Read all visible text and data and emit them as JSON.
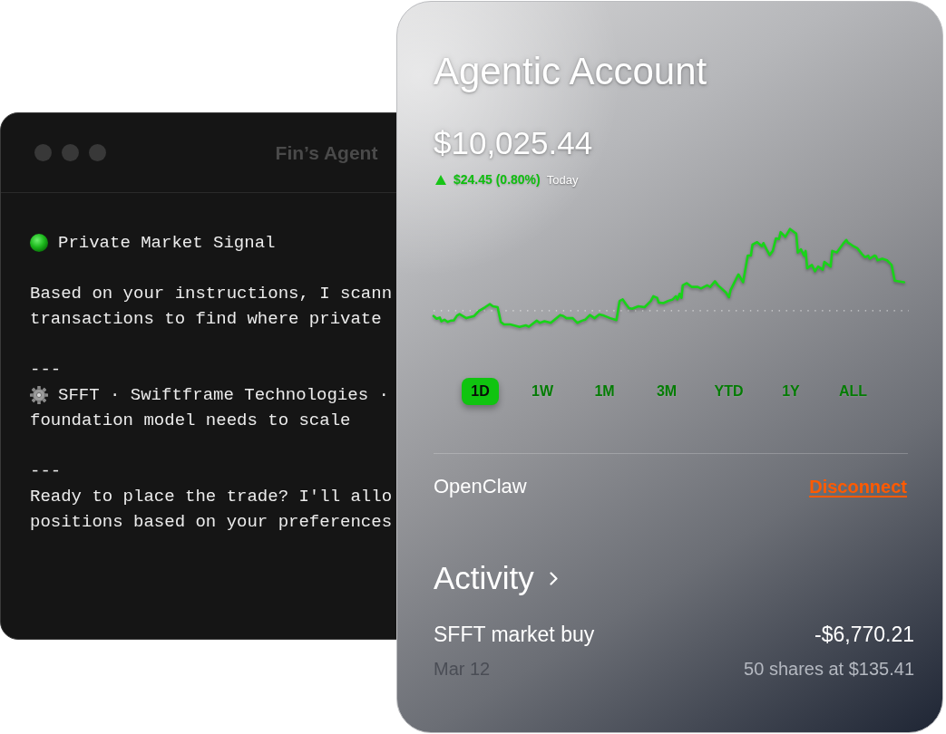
{
  "agent_window": {
    "title": "Fin’s Agent",
    "blocks": [
      {
        "kind": "status",
        "lines": [
          "Private Market Signal"
        ]
      },
      {
        "kind": "text",
        "lines": [
          "Based on your instructions, I scann",
          "transactions to find where private"
        ]
      },
      {
        "kind": "rule",
        "lines": [
          "---"
        ]
      },
      {
        "kind": "gear",
        "lines": [
          "SFFT · Swiftframe Technologies ·",
          "foundation model needs to scale"
        ]
      },
      {
        "kind": "rule",
        "lines": [
          "---"
        ]
      },
      {
        "kind": "text",
        "lines": [
          "Ready to place the trade? I'll allo",
          "positions based on your preferences"
        ]
      }
    ]
  },
  "account_card": {
    "title": "Agentic Account",
    "balance": "$10,025.44",
    "change": {
      "rising": true,
      "amount": "$24.45 (0.80%)",
      "period": "Today"
    },
    "ranges": [
      {
        "label": "1D",
        "selected": true
      },
      {
        "label": "1W",
        "selected": false
      },
      {
        "label": "1M",
        "selected": false
      },
      {
        "label": "3M",
        "selected": false
      },
      {
        "label": "YTD",
        "selected": false
      },
      {
        "label": "1Y",
        "selected": false
      },
      {
        "label": "ALL",
        "selected": false
      }
    ],
    "connection": {
      "name": "OpenClaw",
      "action": "Disconnect"
    },
    "activity": {
      "title": "Activity",
      "items": [
        {
          "title": "SFFT market buy",
          "amount": "-$6,770.21",
          "date": "Mar 12",
          "detail": "50 shares at $135.41"
        }
      ]
    }
  }
}
